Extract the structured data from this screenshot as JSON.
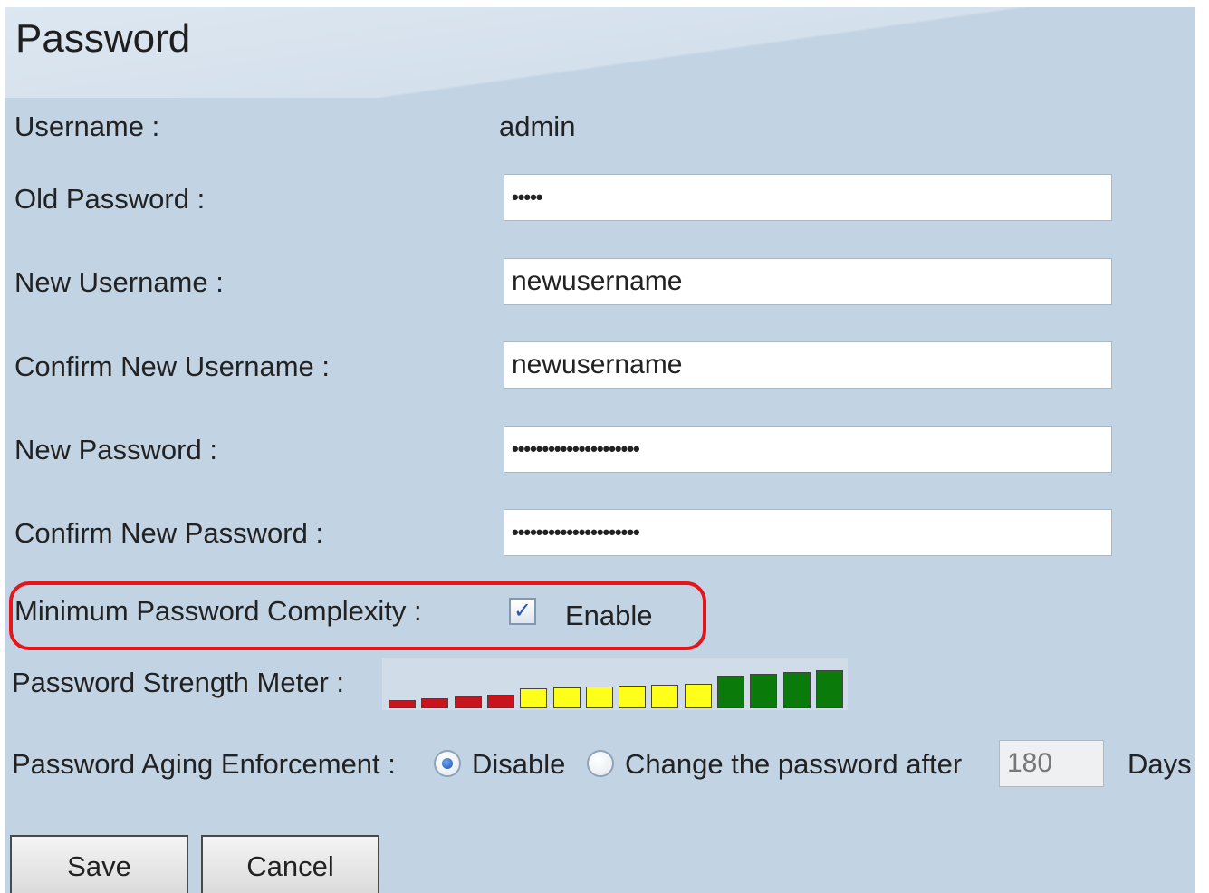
{
  "page_title": "Password",
  "form": {
    "username_label": "Username :",
    "username_value": "admin",
    "old_password_label": "Old Password :",
    "old_password_value": "•••••",
    "new_username_label": "New Username :",
    "new_username_value": "newusername",
    "confirm_new_username_label": "Confirm New Username :",
    "confirm_new_username_value": "newusername",
    "new_password_label": "New Password :",
    "new_password_value": "•••••••••••••••••••••",
    "confirm_new_password_label": "Confirm New Password :",
    "confirm_new_password_value": "•••••••••••••••••••••",
    "min_complexity_label": "Minimum Password Complexity :",
    "min_complexity_option": "Enable",
    "min_complexity_checked": true,
    "strength_meter_label": "Password Strength Meter :",
    "strength_meter_segments": 14,
    "strength_meter_filled": 14,
    "aging_label": "Password Aging Enforcement :",
    "aging_option_disable": "Disable",
    "aging_option_change": "Change the password after",
    "aging_selected": "Disable",
    "aging_days_value": "180",
    "aging_days_unit": "Days"
  },
  "buttons": {
    "save": "Save",
    "cancel": "Cancel"
  },
  "colors": {
    "panel_background": "#c2d3e3",
    "highlight_outline": "#e8141b",
    "meter_red": "#c8151d",
    "meter_yellow": "#ffff1a",
    "meter_green": "#0a7a0a"
  }
}
